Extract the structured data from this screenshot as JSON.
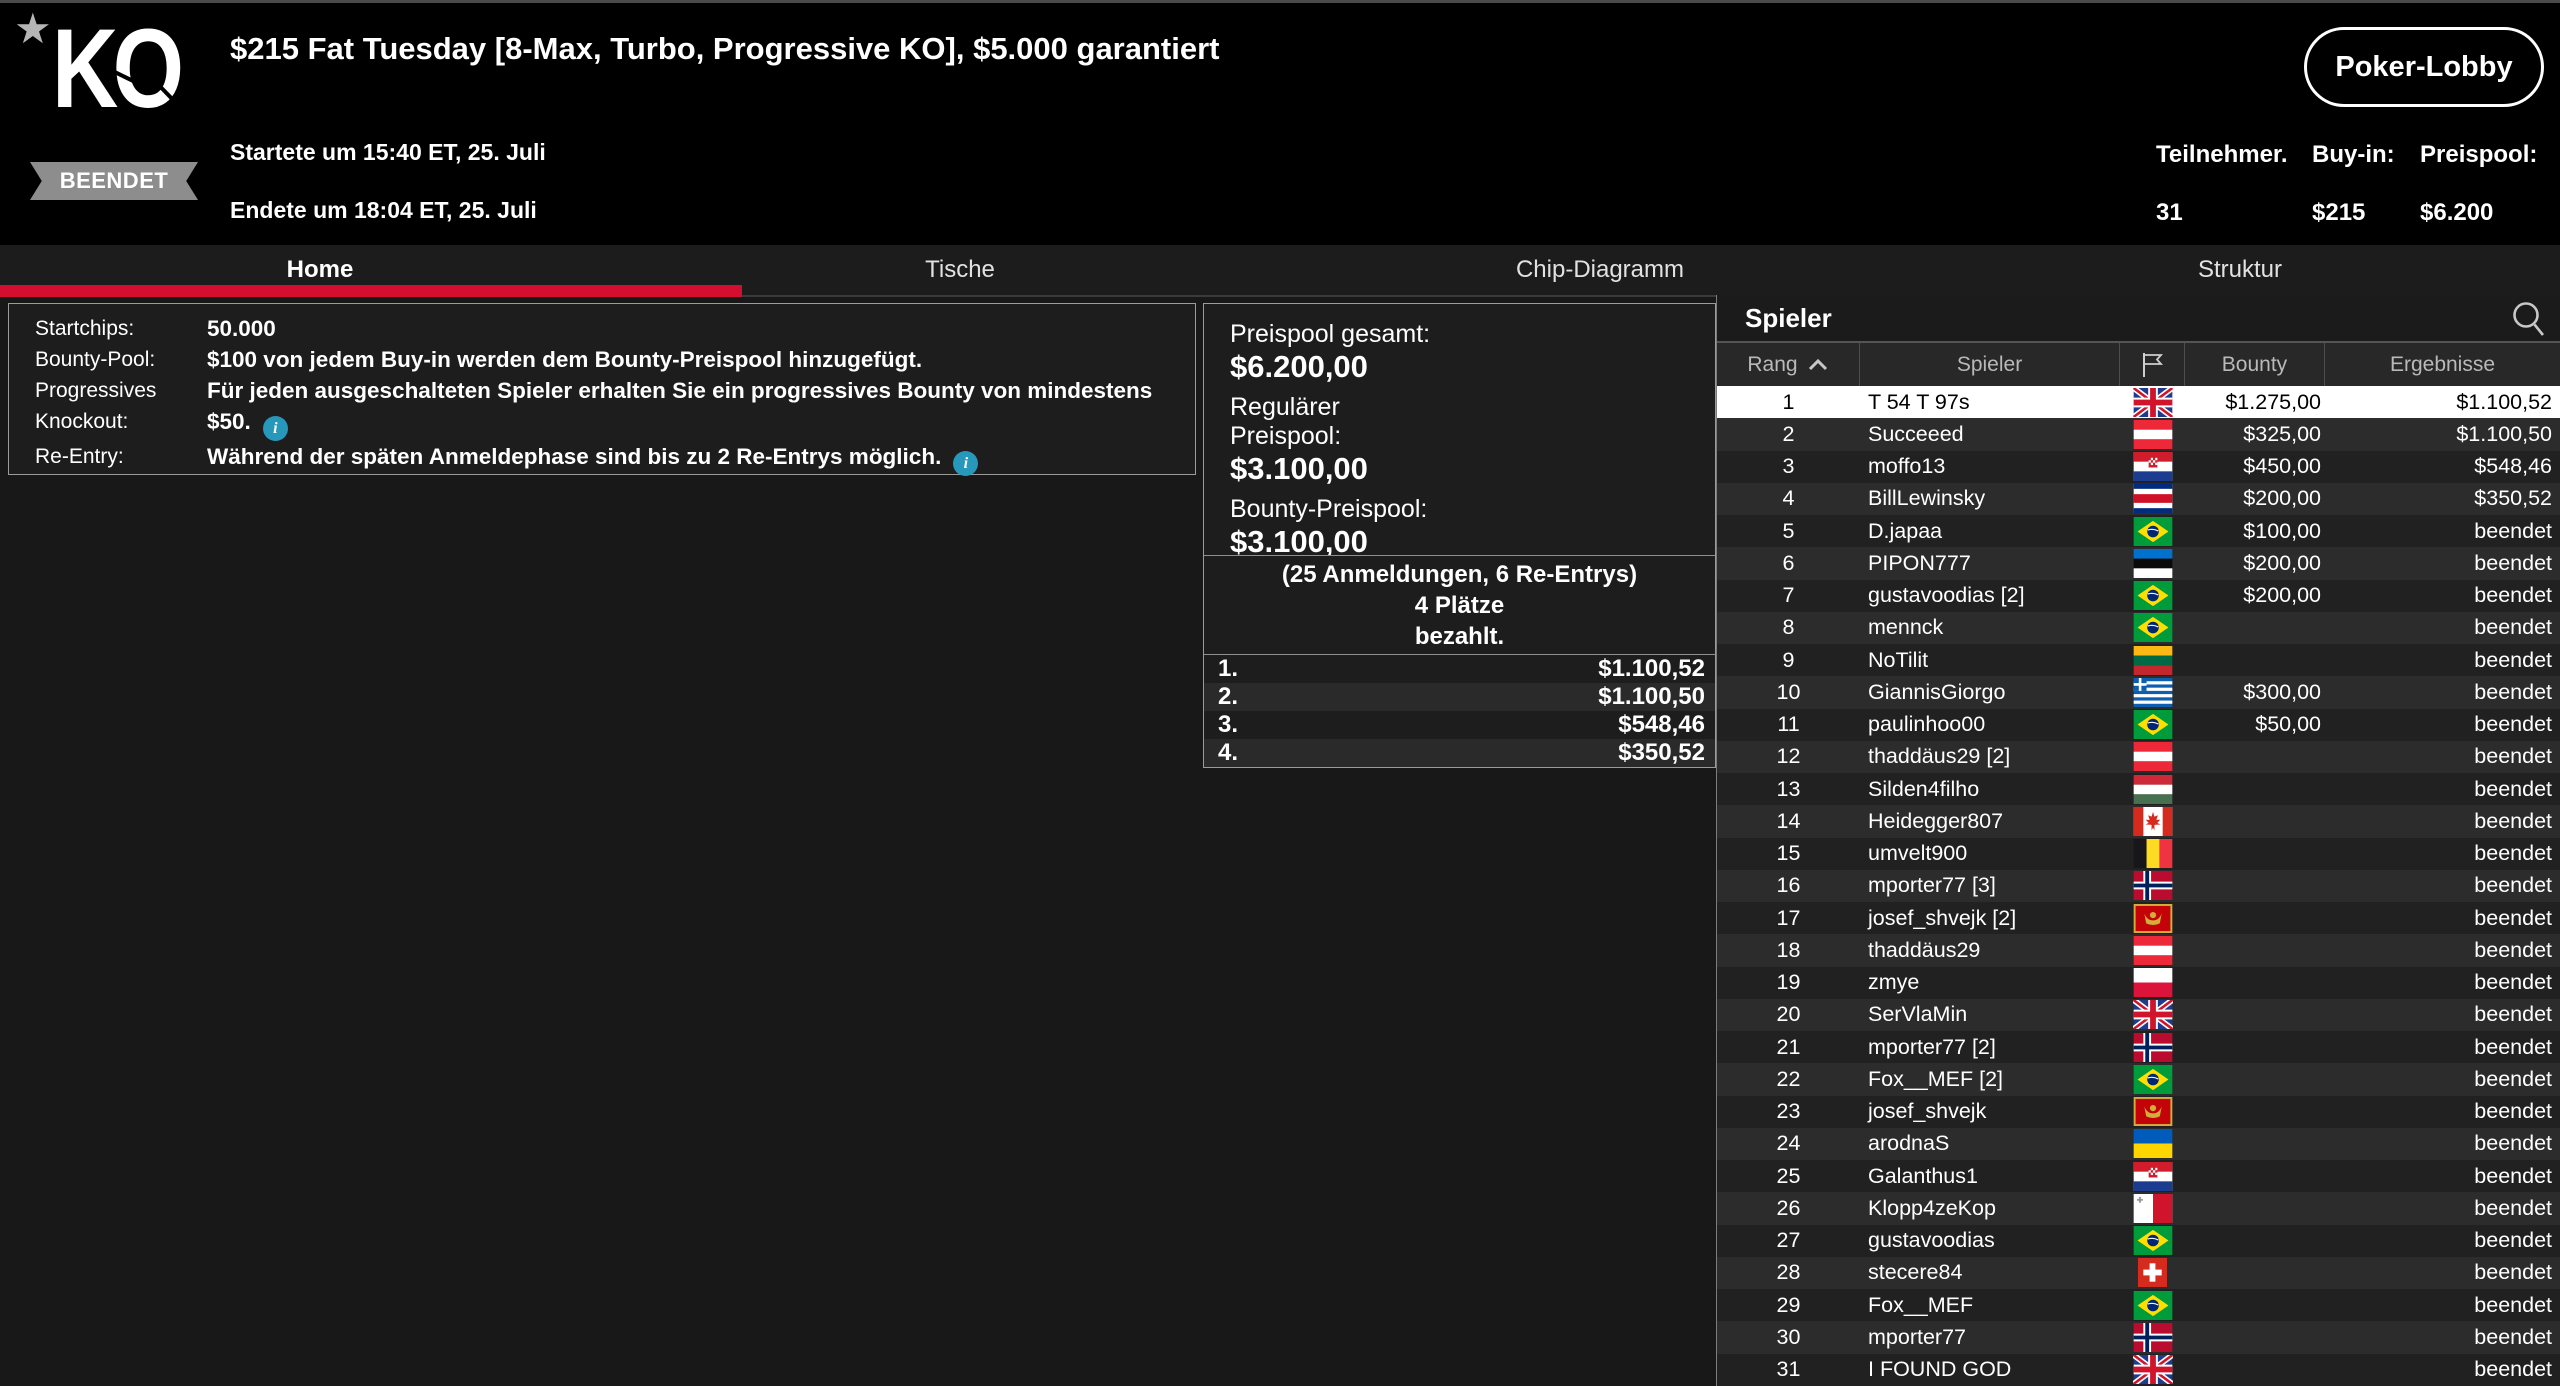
{
  "header": {
    "logo_text": "KO",
    "status_badge": "BEENDET",
    "title": "$215 Fat Tuesday [8-Max, Turbo, Progressive KO], $5.000 garantiert",
    "started": "Startete um 15:40 ET, 25. Juli",
    "ended": "Endete um 18:04 ET, 25. Juli",
    "lobby_button": "Poker-Lobby",
    "stats": [
      {
        "label": "Teilnehmer.",
        "value": "31"
      },
      {
        "label": "Buy-in:",
        "value": "$215"
      },
      {
        "label": "Preispool:",
        "value": "$6.200"
      }
    ]
  },
  "tabs": [
    {
      "label": "Home",
      "active": true
    },
    {
      "label": "Tische",
      "active": false
    },
    {
      "label": "Chip-Diagramm",
      "active": false
    },
    {
      "label": "Struktur",
      "active": false
    }
  ],
  "info_panel": {
    "rows": [
      {
        "label": "Startchips:",
        "value": "50.000",
        "info": false
      },
      {
        "label": "Bounty-Pool:",
        "value": "$100 von jedem Buy-in werden dem Bounty-Preispool hinzugefügt.",
        "info": false
      },
      {
        "label": "Progressives",
        "value": "Für jeden ausgeschalteten Spieler erhalten Sie ein progressives Bounty von mindestens",
        "info": false
      },
      {
        "label": "Knockout:",
        "value": "$50.",
        "info": true
      },
      {
        "label": "Re-Entry:",
        "value": "Während der späten Anmeldephase sind bis zu 2 Re-Entrys möglich.",
        "info": true
      }
    ]
  },
  "prize_panel": {
    "pools": [
      {
        "label_lines": [
          "Preispool gesamt:"
        ],
        "amount": "$6.200,00"
      },
      {
        "label_lines": [
          "Regulärer",
          "Preispool:"
        ],
        "amount": "$3.100,00"
      },
      {
        "label_lines": [
          "Bounty-Preispool:"
        ],
        "amount": "$3.100,00"
      }
    ],
    "registrations": "(25 Anmeldungen, 6 Re-Entrys)",
    "places_line1": "4 Plätze",
    "places_line2": "bezahlt.",
    "payouts": [
      {
        "place": "1.",
        "amount": "$1.100,52"
      },
      {
        "place": "2.",
        "amount": "$1.100,50"
      },
      {
        "place": "3.",
        "amount": "$548,46"
      },
      {
        "place": "4.",
        "amount": "$350,52"
      }
    ]
  },
  "players_panel": {
    "title": "Spieler",
    "columns": [
      {
        "key": "rank",
        "label": "Rang",
        "sorted": "asc"
      },
      {
        "key": "name",
        "label": "Spieler",
        "sorted": ""
      },
      {
        "key": "flag",
        "label": "",
        "sorted": ""
      },
      {
        "key": "bounty",
        "label": "Bounty",
        "sorted": ""
      },
      {
        "key": "result",
        "label": "Ergebnisse",
        "sorted": ""
      }
    ],
    "rows": [
      {
        "rank": "1",
        "name": "T 54 T 97s",
        "flag": "gb",
        "bounty": "$1.275,00",
        "result": "$1.100,52",
        "selected": true
      },
      {
        "rank": "2",
        "name": "Succeeed",
        "flag": "at",
        "bounty": "$325,00",
        "result": "$1.100,50",
        "selected": false
      },
      {
        "rank": "3",
        "name": "moffo13",
        "flag": "hr",
        "bounty": "$450,00",
        "result": "$548,46",
        "selected": false
      },
      {
        "rank": "4",
        "name": "BillLewinsky",
        "flag": "cr",
        "bounty": "$200,00",
        "result": "$350,52",
        "selected": false
      },
      {
        "rank": "5",
        "name": "D.japaa",
        "flag": "br",
        "bounty": "$100,00",
        "result": "beendet",
        "selected": false
      },
      {
        "rank": "6",
        "name": "PIPON777",
        "flag": "ee",
        "bounty": "$200,00",
        "result": "beendet",
        "selected": false
      },
      {
        "rank": "7",
        "name": "gustavoodias [2]",
        "flag": "br",
        "bounty": "$200,00",
        "result": "beendet",
        "selected": false
      },
      {
        "rank": "8",
        "name": "mennck",
        "flag": "br",
        "bounty": "",
        "result": "beendet",
        "selected": false
      },
      {
        "rank": "9",
        "name": "NoTilit",
        "flag": "lt",
        "bounty": "",
        "result": "beendet",
        "selected": false
      },
      {
        "rank": "10",
        "name": "GiannisGiorgo",
        "flag": "gr",
        "bounty": "$300,00",
        "result": "beendet",
        "selected": false
      },
      {
        "rank": "11",
        "name": "paulinhoo00",
        "flag": "br",
        "bounty": "$50,00",
        "result": "beendet",
        "selected": false
      },
      {
        "rank": "12",
        "name": "thaddäus29 [2]",
        "flag": "at",
        "bounty": "",
        "result": "beendet",
        "selected": false
      },
      {
        "rank": "13",
        "name": "Silden4filho",
        "flag": "hu",
        "bounty": "",
        "result": "beendet",
        "selected": false
      },
      {
        "rank": "14",
        "name": "Heidegger807",
        "flag": "ca",
        "bounty": "",
        "result": "beendet",
        "selected": false
      },
      {
        "rank": "15",
        "name": "umvelt900",
        "flag": "be",
        "bounty": "",
        "result": "beendet",
        "selected": false
      },
      {
        "rank": "16",
        "name": "mporter77 [3]",
        "flag": "no",
        "bounty": "",
        "result": "beendet",
        "selected": false
      },
      {
        "rank": "17",
        "name": "josef_shvejk [2]",
        "flag": "me",
        "bounty": "",
        "result": "beendet",
        "selected": false
      },
      {
        "rank": "18",
        "name": "thaddäus29",
        "flag": "at",
        "bounty": "",
        "result": "beendet",
        "selected": false
      },
      {
        "rank": "19",
        "name": "zmye",
        "flag": "pl",
        "bounty": "",
        "result": "beendet",
        "selected": false
      },
      {
        "rank": "20",
        "name": "SerVlaMin",
        "flag": "gb",
        "bounty": "",
        "result": "beendet",
        "selected": false
      },
      {
        "rank": "21",
        "name": "mporter77 [2]",
        "flag": "no",
        "bounty": "",
        "result": "beendet",
        "selected": false
      },
      {
        "rank": "22",
        "name": "Fox__MEF [2]",
        "flag": "br",
        "bounty": "",
        "result": "beendet",
        "selected": false
      },
      {
        "rank": "23",
        "name": "josef_shvejk",
        "flag": "me",
        "bounty": "",
        "result": "beendet",
        "selected": false
      },
      {
        "rank": "24",
        "name": "arodnaS",
        "flag": "ua",
        "bounty": "",
        "result": "beendet",
        "selected": false
      },
      {
        "rank": "25",
        "name": "Galanthus1",
        "flag": "hr",
        "bounty": "",
        "result": "beendet",
        "selected": false
      },
      {
        "rank": "26",
        "name": "Klopp4zeKop",
        "flag": "mt",
        "bounty": "",
        "result": "beendet",
        "selected": false
      },
      {
        "rank": "27",
        "name": "gustavoodias",
        "flag": "br",
        "bounty": "",
        "result": "beendet",
        "selected": false
      },
      {
        "rank": "28",
        "name": "stecere84",
        "flag": "ch",
        "bounty": "",
        "result": "beendet",
        "selected": false
      },
      {
        "rank": "29",
        "name": "Fox__MEF",
        "flag": "br",
        "bounty": "",
        "result": "beendet",
        "selected": false
      },
      {
        "rank": "30",
        "name": "mporter77",
        "flag": "no",
        "bounty": "",
        "result": "beendet",
        "selected": false
      },
      {
        "rank": "31",
        "name": "I FOUND GOD",
        "flag": "gb",
        "bounty": "",
        "result": "beendet",
        "selected": false
      }
    ]
  },
  "colors": {
    "accent_red": "#d40e2e",
    "info_badge": "#2798bb",
    "selected_row_bg": "#ffffff",
    "status_ribbon": "#8d8d8d"
  }
}
